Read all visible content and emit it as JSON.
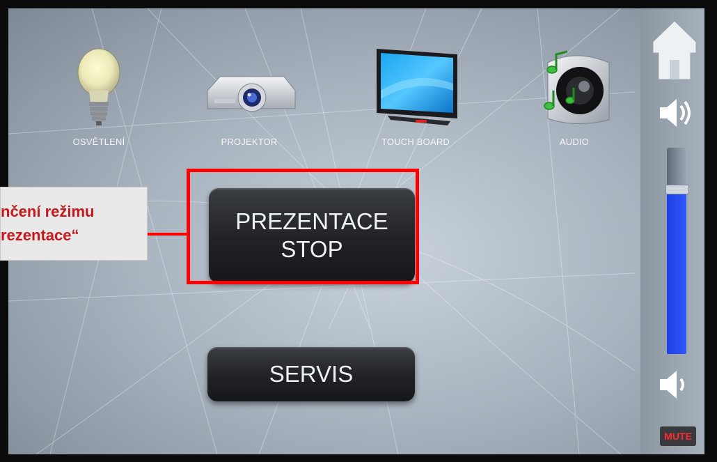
{
  "devices": [
    {
      "id": "lights",
      "label": "OSVĚTLENÍ",
      "icon": "light-bulb-icon"
    },
    {
      "id": "projector",
      "label": "PROJEKTOR",
      "icon": "projector-icon"
    },
    {
      "id": "touchboard",
      "label": "TOUCH BOARD",
      "icon": "touch-board-icon"
    },
    {
      "id": "audio",
      "label": "AUDIO",
      "icon": "speaker-icon"
    }
  ],
  "main": {
    "stop_line1": "PREZENTACE",
    "stop_line2": "STOP",
    "servis": "SERVIS"
  },
  "callout": {
    "line1": "nčení režimu",
    "line2": "rezentace“"
  },
  "sidebar": {
    "home_icon": "home-icon",
    "volume_up_icon": "volume-up-icon",
    "volume_down_icon": "volume-down-icon",
    "volume_level": 0.8,
    "mute_label": "MUTE"
  },
  "colors": {
    "highlight": "#ff0000",
    "callout_text": "#c8171b",
    "volume_fill": "#2f59ff",
    "mute_text": "#ff2a2a"
  }
}
